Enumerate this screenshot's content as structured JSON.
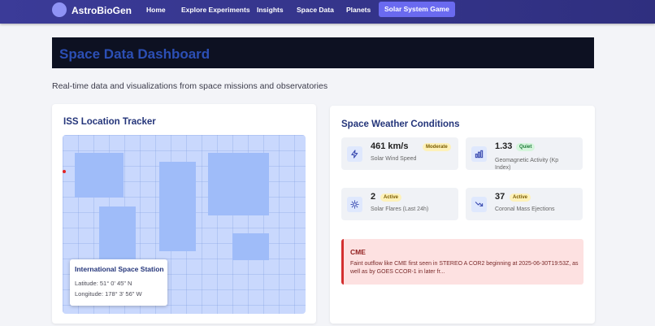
{
  "nav": {
    "brand": "AstroBioGen",
    "items": [
      "Home",
      "Explore Experiments",
      "Insights",
      "Space Data",
      "Planets"
    ],
    "game_label": "Solar System Game"
  },
  "header": {
    "title": "Space Data Dashboard",
    "subtitle": "Real-time data and visualizations from space missions and observatories"
  },
  "iss": {
    "title": "ISS Location Tracker",
    "popup_title": "International Space Station",
    "latitude": "Latitude: 51° 0' 45\" N",
    "longitude": "Longitude: 178° 3' 56\" W"
  },
  "weather": {
    "title": "Space Weather Conditions",
    "metrics": [
      {
        "value": "461 km/s",
        "badge": "Moderate",
        "label": "Solar Wind Speed",
        "icon": "lightning-icon"
      },
      {
        "value": "1.33",
        "badge": "Quiet",
        "label_1": "Geomagnetic Activity (Kp",
        "label_2": "Index)",
        "icon": "bar-chart-icon"
      },
      {
        "value": "2",
        "badge": "Active",
        "label": "Solar Flares (Last 24h)",
        "icon": "sun-icon"
      },
      {
        "value": "37",
        "badge": "Active",
        "label": "Coronal Mass Ejections",
        "icon": "trending-down-icon"
      }
    ],
    "alert": {
      "title": "CME",
      "body": "Faint outflow like CME first seen in STEREO A COR2 beginning at 2025-06-30T19:53Z, as well as by GOES CCOR-1 in later fr..."
    }
  },
  "colors": {
    "nav": "#3b3b98",
    "accent": "#6a6af0",
    "title_blue": "#24357a",
    "alert_red": "#d32f2f"
  }
}
